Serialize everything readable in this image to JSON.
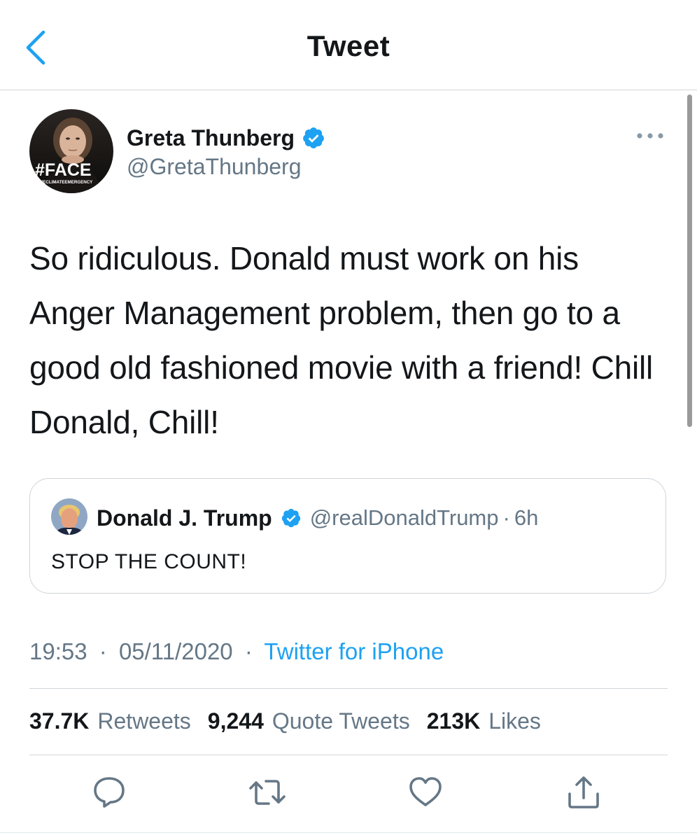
{
  "header": {
    "title": "Tweet"
  },
  "tweet": {
    "author": {
      "name": "Greta Thunberg",
      "handle": "@GretaThunberg",
      "avatar_badge": "#FACE",
      "avatar_subtext": "THECLIMATEEMERGENCY"
    },
    "text": "So ridiculous. Donald must work on his Anger Management problem, then go to a good old fashioned movie with a friend! Chill Donald, Chill!",
    "time": "19:53",
    "separator": "·",
    "date": "05/11/2020",
    "source": "Twitter for iPhone"
  },
  "quoted_tweet": {
    "name": "Donald J. Trump",
    "handle": "@realDonaldTrump",
    "age": "6h",
    "separator": "·",
    "text": "STOP THE COUNT!"
  },
  "stats": {
    "retweets_count": "37.7K",
    "retweets_label": "Retweets",
    "quotes_count": "9,244",
    "quotes_label": "Quote Tweets",
    "likes_count": "213K",
    "likes_label": "Likes"
  },
  "icons": {
    "back": "chevron-left-icon",
    "more": "more-horizontal-icon",
    "verified": "verified-badge-icon",
    "reply": "reply-icon",
    "retweet": "retweet-icon",
    "like": "heart-icon",
    "share": "share-icon"
  },
  "colors": {
    "accent": "#1da1f2",
    "text_primary": "#14171a",
    "text_secondary": "#657786",
    "border": "#d0d5d9"
  }
}
